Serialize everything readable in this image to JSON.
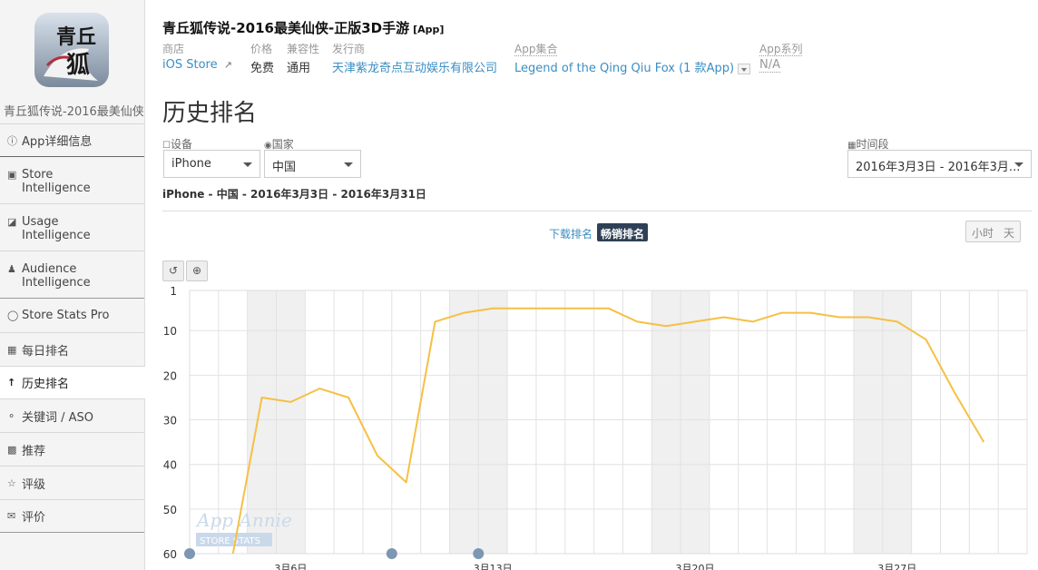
{
  "app": {
    "title": "青丘狐传说-2016最美仙侠-正版3D手游",
    "type_tag": "[App]",
    "sidebar_name": "青丘狐传说-2016最美仙侠...",
    "icon_text": "青丘狐"
  },
  "meta": {
    "store_label": "商店",
    "store_value": "iOS Store",
    "price_label": "价格",
    "price_value": "免费",
    "compat_label": "兼容性",
    "compat_value": "通用",
    "publisher_label": "发行商",
    "publisher_value": "天津紫龙奇点互动娱乐有限公司",
    "collection_label": "App集合",
    "collection_value": "Legend of the Qing Qiu Fox (1 款App)",
    "series_label": "App系列",
    "series_value": "N/A"
  },
  "sidebar": {
    "items": [
      {
        "label": "App详细信息",
        "icon": "info-icon"
      },
      {
        "label": "Store",
        "label2": "Intelligence",
        "icon": "store-icon"
      },
      {
        "label": "Usage",
        "label2": "Intelligence",
        "icon": "usage-icon"
      },
      {
        "label": "Audience",
        "label2": "Intelligence",
        "icon": "person-icon"
      },
      {
        "label": "Store Stats Pro",
        "icon": "gauge-icon"
      },
      {
        "label": "每日排名",
        "icon": "calendar-icon"
      },
      {
        "label": "历史排名",
        "icon": "arrow-up-icon"
      },
      {
        "label": "关键词 / ASO",
        "icon": "key-icon"
      },
      {
        "label": "推荐",
        "icon": "bookmark-icon"
      },
      {
        "label": "评级",
        "icon": "star-icon"
      },
      {
        "label": "评价",
        "icon": "comment-icon"
      }
    ]
  },
  "page": {
    "title": "历史排名",
    "device_label": "设备",
    "device_value": "iPhone",
    "country_label": "国家",
    "country_value": "中国",
    "period_label": "时间段",
    "period_value": "2016年3月3日 - 2016年3月...",
    "subtitle": "iPhone - 中国 - 2016年3月3日 - 2016年3月31日",
    "tab_downloads": "下载排名",
    "tab_grossing": "畅销排名",
    "btn_hour": "小时",
    "btn_day": "天",
    "watermark_top": "App Annie",
    "watermark_bottom": "STORE STATS"
  },
  "colors": {
    "line": "#f5c044",
    "accent_link": "#3a8ec4",
    "active_tab": "#2f4056",
    "weekend_band": "#f0f0f0"
  },
  "chart_data": {
    "type": "line",
    "y_reversed": true,
    "ylim": [
      1,
      60
    ],
    "y_ticks": [
      1,
      10,
      20,
      30,
      40,
      50,
      60
    ],
    "x_tick_labels": [
      "3月6日",
      "3月13日",
      "3月20日",
      "3月27日"
    ],
    "x": [
      "3/3",
      "3/4",
      "3/5",
      "3/6",
      "3/7",
      "3/8",
      "3/9",
      "3/10",
      "3/11",
      "3/12",
      "3/13",
      "3/14",
      "3/15",
      "3/16",
      "3/17",
      "3/18",
      "3/19",
      "3/20",
      "3/21",
      "3/22",
      "3/23",
      "3/24",
      "3/25",
      "3/26",
      "3/27",
      "3/28",
      "3/29",
      "3/30",
      "3/31"
    ],
    "series": [
      {
        "values": [
          null,
          60,
          25,
          26,
          23,
          25,
          38,
          44,
          8,
          6,
          5,
          5,
          5,
          5,
          5,
          8,
          9,
          8,
          7,
          8,
          6,
          6,
          7,
          7,
          8,
          12,
          24,
          35,
          null
        ]
      }
    ],
    "grid": true,
    "weekend_bands": [
      "3/5-3/6",
      "3/12-3/13",
      "3/19-3/20",
      "3/26-3/27"
    ]
  }
}
